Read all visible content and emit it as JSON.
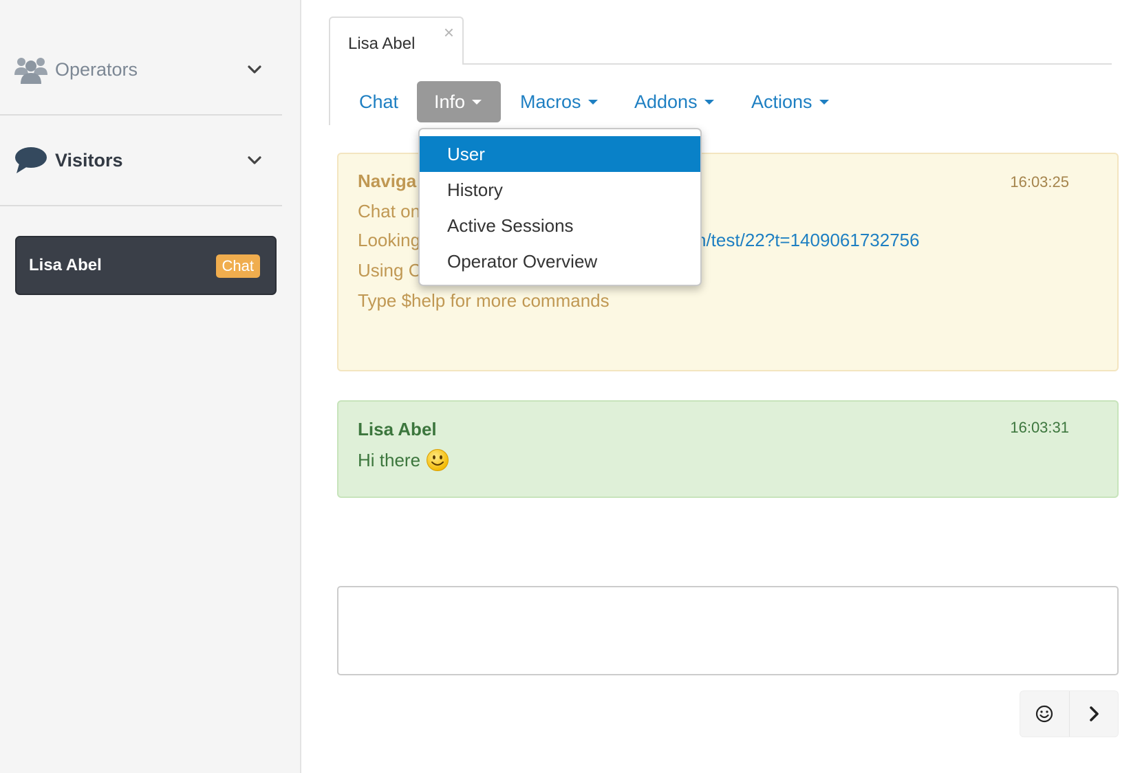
{
  "sidebar": {
    "sections": [
      {
        "label": "Operators",
        "icon": "users-icon"
      },
      {
        "label": "Visitors",
        "icon": "chat-bubble-icon"
      }
    ],
    "visitor": {
      "name": "Lisa Abel",
      "badge": "Chat"
    }
  },
  "tab": {
    "title": "Lisa Abel",
    "close": "×"
  },
  "nav": {
    "chat": "Chat",
    "info": "Info",
    "macros": "Macros",
    "addons": "Addons",
    "actions": "Actions"
  },
  "dropdown": {
    "items": [
      "User",
      "History",
      "Active Sessions",
      "Operator Overview"
    ],
    "selected": "User"
  },
  "messages": {
    "system": {
      "title_partial": "Naviga",
      "line1_partial": "Chat on",
      "line2_partial": "Looking",
      "line3_partial": "Using C",
      "line4": "Type $help for more commands",
      "link_partial": "n/test/22?t=1409061732756",
      "time": "16:03:25"
    },
    "user": {
      "name": "Lisa Abel",
      "text": "Hi there",
      "emoji": "smiley-icon",
      "time": "16:03:31"
    }
  },
  "composer": {
    "value": ""
  },
  "buttons": {
    "emoji": "smiley-face-icon",
    "send": "chevron-right-icon"
  },
  "colors": {
    "link": "#1e7fc2",
    "system_bg": "#fcf8e3",
    "system_text": "#c09853",
    "user_bg": "#dff0d8",
    "user_text": "#3c763d",
    "badge": "#f0ad4e",
    "dropdown_active": "#0981c8"
  }
}
